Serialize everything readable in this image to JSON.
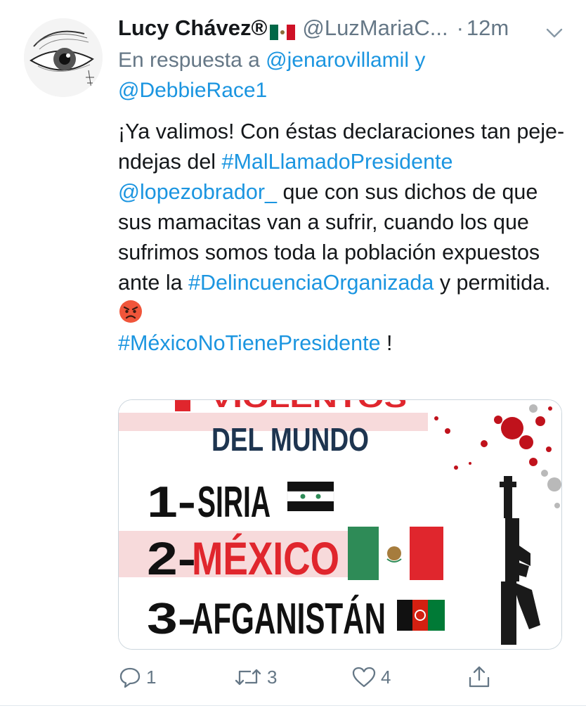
{
  "tweet": {
    "display_name": "Lucy Chávez®",
    "name_flag": "mexico-flag-icon",
    "handle": "@LuzMariaC...",
    "dot": "·",
    "time": "12m",
    "reply_prefix": "En respuesta a",
    "reply_user1": "@jenarovillamil",
    "reply_and": "y",
    "reply_user2": "@DebbieRace1",
    "text": {
      "p1": "¡Ya valimos! Con éstas declaraciones tan peje-ndejas del",
      "hashtag1": "#MalLlamadoPresidente",
      "mention": "@lopezobrador_",
      "p2": "que con sus dichos de que sus mamacitas van a sufrir, cuando los que sufrimos somos toda la población expuestos ante la",
      "hashtag2": "#DelincuenciaOrganizada",
      "p3": "y permitida.",
      "emoji": "angry-face-icon",
      "hashtag3": "#MéxicoNoTienePresidente",
      "p4": "!"
    }
  },
  "media": {
    "top_text": "VIOLENTOS",
    "subtitle": "DEL MUNDO",
    "rank1_num": "1-",
    "rank1_country": "SIRIA",
    "rank2_num": "2-",
    "rank2_country": "MÉXICO",
    "rank3_num": "3-",
    "rank3_country": "AFGANISTÁN",
    "colors": {
      "red": "#e0262d",
      "navy": "#1e3550",
      "dark": "#111111",
      "green": "#2e8b57",
      "band": "#f7dadb"
    }
  },
  "actions": {
    "replies": "1",
    "retweets": "3",
    "likes": "4"
  },
  "colors": {
    "link": "#1b95e0",
    "muted": "#657786",
    "text": "#14171a"
  }
}
